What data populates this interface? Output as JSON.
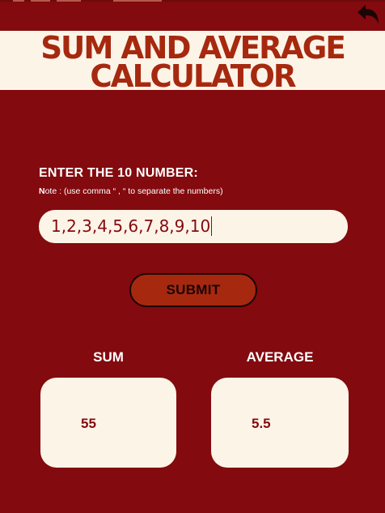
{
  "header": {
    "title_line1": "SUM AND AVERAGE",
    "title_line2": "CALCULATOR",
    "back_icon": "back-arrow-icon"
  },
  "form": {
    "prompt": "ENTER  THE 10 NUMBER:",
    "note_prefix": "N",
    "note_rest": "ote : (use comma “ , “ to separate the numbers)",
    "input_value": "1,2,3,4,5,6,7,8,9,10",
    "submit_label": "SUBMIT"
  },
  "results": {
    "sum_label": "SUM",
    "sum_value": "55",
    "average_label": "AVERAGE",
    "average_value": "5.5"
  },
  "colors": {
    "background": "#830a0e",
    "cream": "#fdf4e8",
    "accent": "#a6290f"
  }
}
